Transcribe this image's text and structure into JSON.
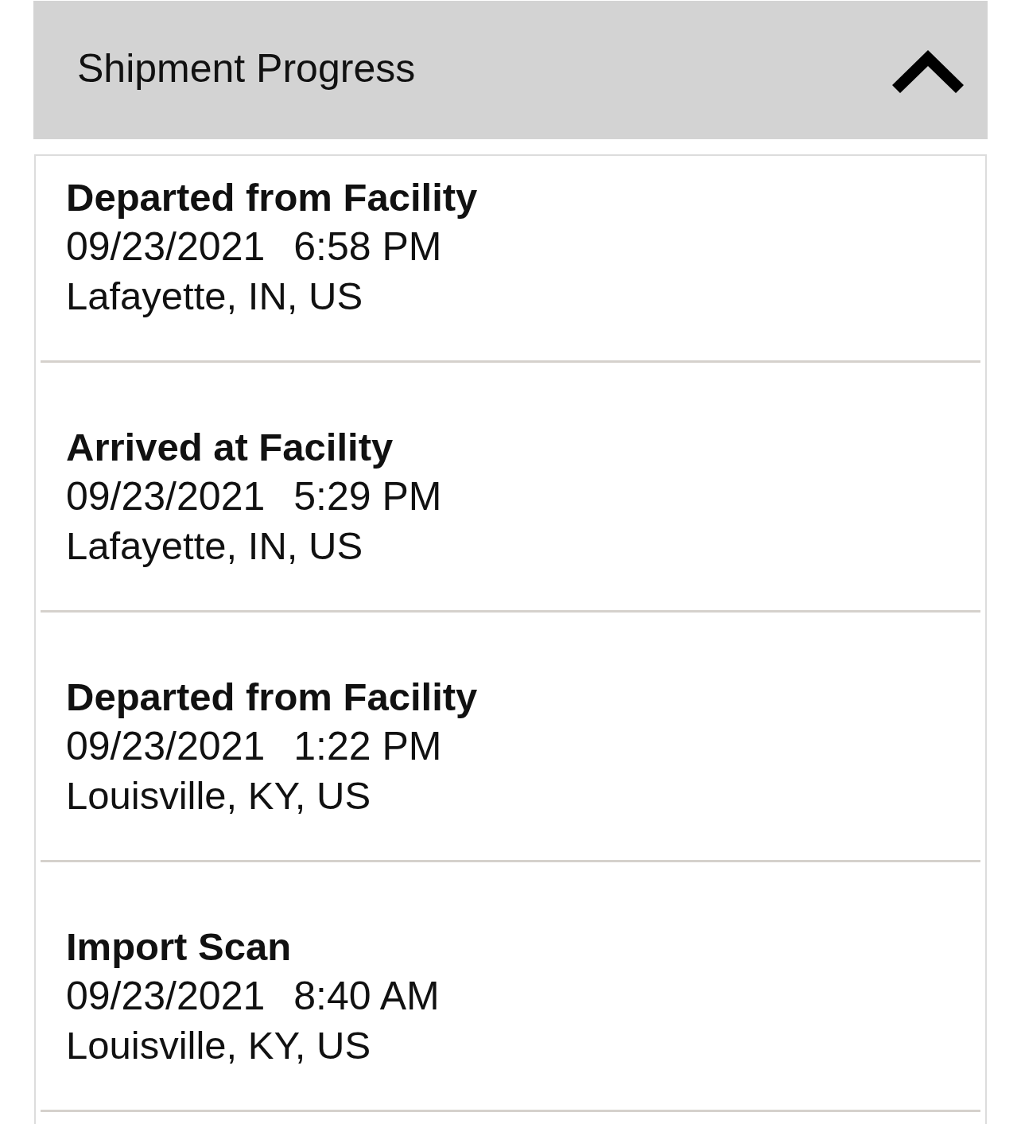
{
  "section": {
    "title": "Shipment Progress",
    "expanded": true
  },
  "events": [
    {
      "status": "Departed from Facility",
      "date": "09/23/2021",
      "time": "6:58 PM",
      "location": "Lafayette, IN, US"
    },
    {
      "status": "Arrived at Facility",
      "date": "09/23/2021",
      "time": "5:29 PM",
      "location": "Lafayette, IN, US"
    },
    {
      "status": "Departed from Facility",
      "date": "09/23/2021",
      "time": "1:22 PM",
      "location": "Louisville, KY, US"
    },
    {
      "status": "Import Scan",
      "date": "09/23/2021",
      "time": "8:40 AM",
      "location": "Louisville, KY, US"
    }
  ]
}
